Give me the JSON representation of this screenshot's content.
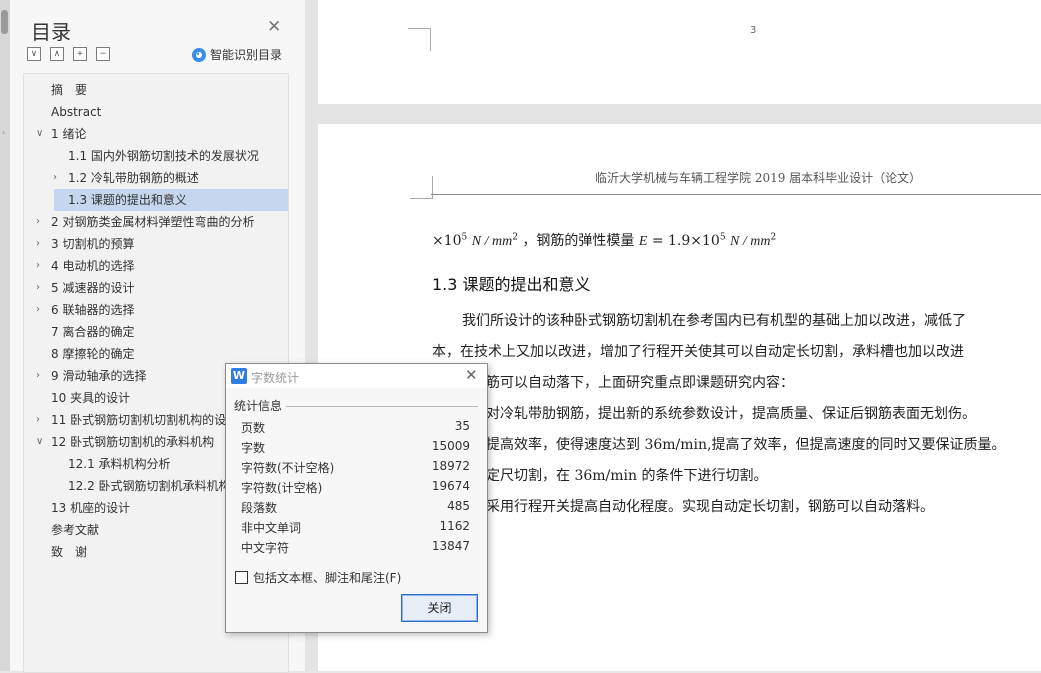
{
  "toc": {
    "title": "目录",
    "smart_label": "智能识别目录",
    "tools": [
      "∨",
      "∧",
      "+",
      "−"
    ],
    "items": [
      {
        "label": "摘　要",
        "level": 0,
        "arrow": ""
      },
      {
        "label": "Abstract",
        "level": 0,
        "arrow": ""
      },
      {
        "label": "1  绪论",
        "level": 0,
        "arrow": "∨"
      },
      {
        "label": "1.1  国内外钢筋切割技术的发展状况",
        "level": 1,
        "arrow": ""
      },
      {
        "label": "1.2  冷轧带肋钢筋的概述",
        "level": 1,
        "arrow": "›"
      },
      {
        "label": "1.3  课题的提出和意义",
        "level": 1,
        "arrow": "",
        "selected": true
      },
      {
        "label": "2  对钢筋类金属材料弹塑性弯曲的分析",
        "level": 0,
        "arrow": "›"
      },
      {
        "label": "3  切割机的预算",
        "level": 0,
        "arrow": "›"
      },
      {
        "label": "4  电动机的选择",
        "level": 0,
        "arrow": "›"
      },
      {
        "label": "5  减速器的设计",
        "level": 0,
        "arrow": "›"
      },
      {
        "label": "6  联轴器的选择",
        "level": 0,
        "arrow": "›"
      },
      {
        "label": "7  离合器的确定",
        "level": 0,
        "arrow": ""
      },
      {
        "label": "8  摩擦轮的确定",
        "level": 0,
        "arrow": ""
      },
      {
        "label": "9  滑动轴承的选择",
        "level": 0,
        "arrow": "›"
      },
      {
        "label": "10  夹具的设计",
        "level": 0,
        "arrow": ""
      },
      {
        "label": "11  卧式钢筋切割机切割机构的设",
        "level": 0,
        "arrow": "›"
      },
      {
        "label": "12  卧式钢筋切割机的承料机构",
        "level": 0,
        "arrow": "∨"
      },
      {
        "label": "12.1  承料机构分析",
        "level": 1,
        "arrow": ""
      },
      {
        "label": "12.2  卧式钢筋切割机承料机构",
        "level": 1,
        "arrow": ""
      },
      {
        "label": "13  机座的设计",
        "level": 0,
        "arrow": ""
      },
      {
        "label": "参考文献",
        "level": 0,
        "arrow": ""
      },
      {
        "label": "致　谢",
        "level": 0,
        "arrow": ""
      }
    ]
  },
  "document": {
    "page_number": "3",
    "header": "临沂大学机械与车辆工程学院 2019 届本科毕业设计（论文）",
    "formula_prefix": "×10",
    "formula_unit": "N / mm",
    "formula_text": "，钢筋的弹性模量",
    "formula_e": "E",
    "formula_value": "= 1.9×10",
    "heading": "1.3  课题的提出和意义",
    "paragraphs": [
      "我们所设计的该种卧式钢筋切割机在参考国内已有机型的基础上加以改进，减低了",
      "本，在技术上又加以改进，增加了行程开关使其可以自动定长切割，承料槽也加以改进",
      "筋可以自动落下，上面研究重点即课题研究内容：",
      "对冷轧带肋钢筋，提出新的系统参数设计，提高质量、保证后钢筋表面无划伤。",
      "提高效率，使得速度达到 36m/min,提高了效率，但提高速度的同时又要保证质量。",
      "定尺切割，在 36m/min 的条件下进行切割。",
      "采用行程开关提高自动化程度。实现自动定长切割，钢筋可以自动落料。"
    ]
  },
  "dialog": {
    "title": "字数统计",
    "icon": "W",
    "group_label": "统计信息",
    "stats": [
      {
        "label": "页数",
        "value": "35"
      },
      {
        "label": "字数",
        "value": "15009"
      },
      {
        "label": "字符数(不计空格)",
        "value": "18972"
      },
      {
        "label": "字符数(计空格)",
        "value": "19674"
      },
      {
        "label": "段落数",
        "value": "485"
      },
      {
        "label": "非中文单词",
        "value": "1162"
      },
      {
        "label": "中文字符",
        "value": "13847"
      }
    ],
    "checkbox_label": "包括文本框、脚注和尾注(F)",
    "checkbox_checked": false,
    "close_button": "关闭"
  }
}
